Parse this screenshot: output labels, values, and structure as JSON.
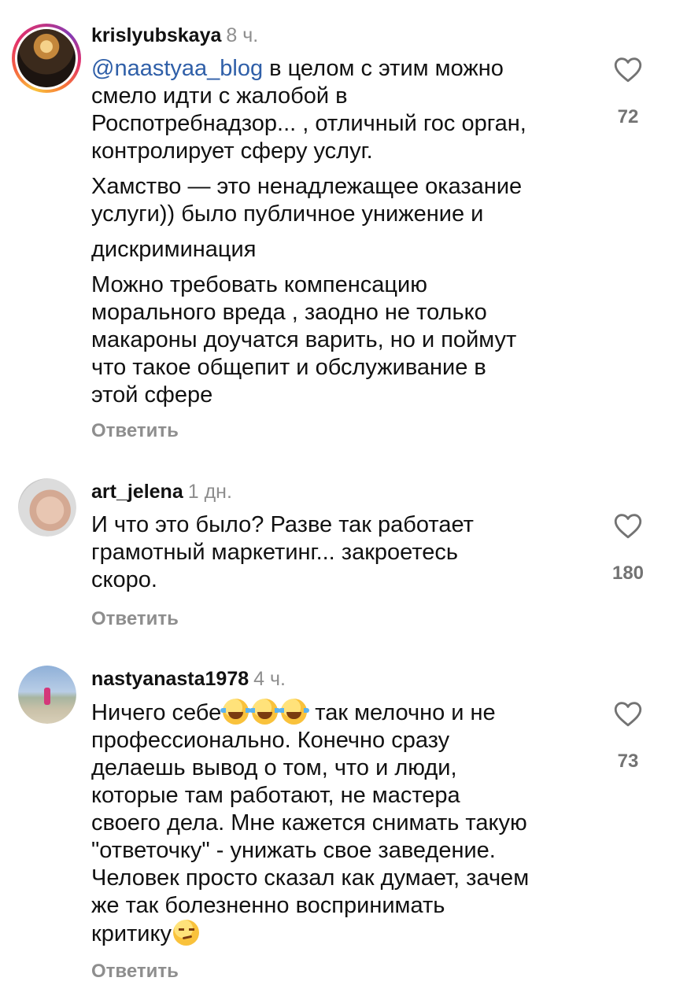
{
  "comments": [
    {
      "username": "krislyubskaya",
      "time": "8 ч.",
      "mention": "@naastyaa_blog",
      "paragraphs": [
        " в целом с этим можно\nсмело идти с жалобой в\nРоспотребнадзор... , отличный гос орган,\nконтролирует сферу услуг.",
        "Хамство — это ненадлежащее оказание\nуслуги)) было публичное унижение и",
        "дискриминация",
        "Можно требовать компенсацию\nморального вреда , заодно не только\nмакароны доучатся варить, но и поймут\nчто такое общепит и обслуживание в\nэтой сфере"
      ],
      "reply_label": "Ответить",
      "likes": "72"
    },
    {
      "username": "art_jelena",
      "time": "1 дн.",
      "paragraphs": [
        "И что это было? Разве так работает\nграмотный маркетинг... закроетесь\nскоро."
      ],
      "reply_label": "Ответить",
      "likes": "180"
    },
    {
      "username": "nastyanasta1978",
      "time": "4 ч.",
      "text_start": "Ничего себе",
      "text_after_emoji": " так мелочно и не\nпрофессионально. Конечно сразу\nделаешь вывод о том, что и люди,\nкоторые там работают, не мастера\nсвоего дела. Мне кажется снимать такую\n\"ответочку\" - унижать свое заведение.\nЧеловек просто сказал как думает, зачем\nже так болезненно воспринимать\nкритику",
      "reply_label": "Ответить",
      "likes": "73"
    }
  ],
  "icons": {
    "like": "heart-outline-icon",
    "emoji_laugh": "face-with-tears-of-joy-emoji",
    "emoji_smirk": "smirking-face-emoji"
  },
  "colors": {
    "mention": "#2f5fa8",
    "muted": "#8e8e8e",
    "text": "#111111"
  }
}
